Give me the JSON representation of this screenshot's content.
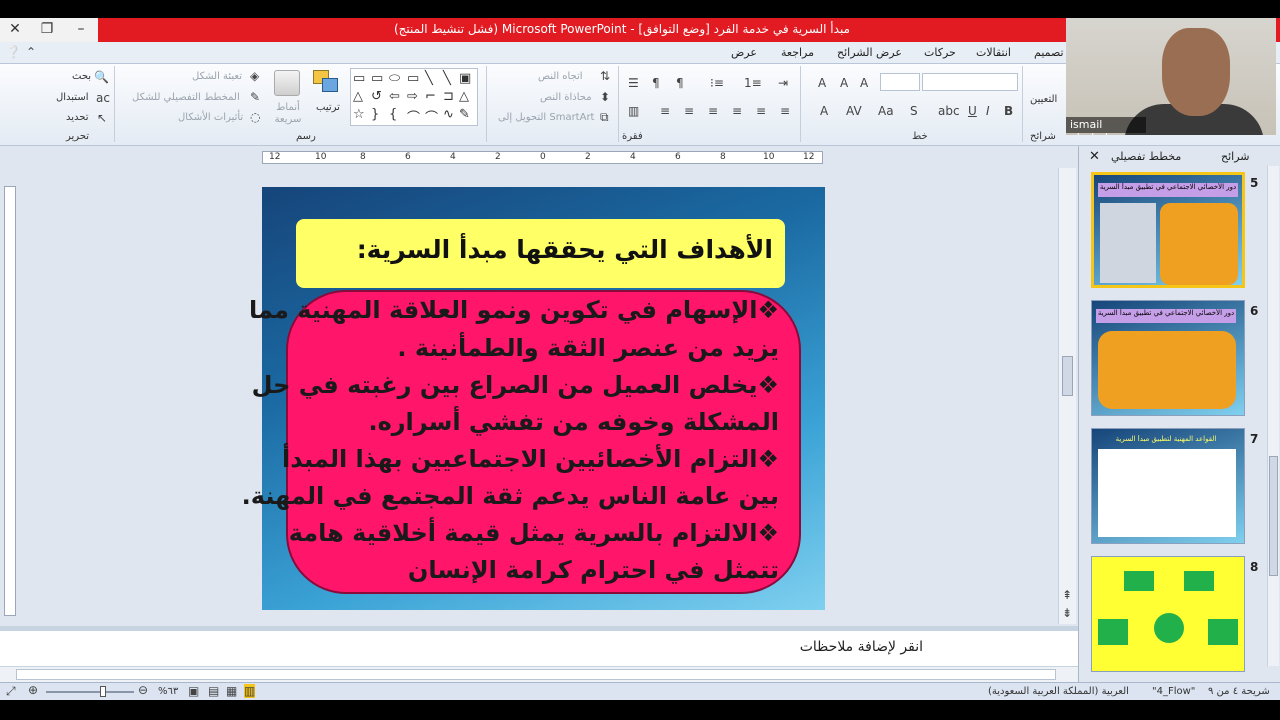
{
  "window": {
    "title": "مبدأ السرية في خدمة الفرد [وضع التوافق] - Microsoft PowerPoint (فشل تنشيط المنتج)",
    "colors": {
      "titlebar": "#e21b23",
      "slide_title_bg": "#ffff66",
      "slide_body_bg": "#ff1569"
    }
  },
  "ribbon_tabs": [
    "تصميم",
    "انتقالات",
    "حركات",
    "عرض الشرائح",
    "مراجعة",
    "عرض"
  ],
  "ribbon": {
    "editing": {
      "find": "بحث",
      "replace": "استبدال",
      "select": "تحديد",
      "group": "تحرير"
    },
    "drawing": {
      "fill": "تعبئة الشكل",
      "outline": "المخطط التفصيلي للشكل",
      "effects": "تأثيرات الأشكال",
      "quick_styles": "أنماط سريعة",
      "arrange": "ترتيب",
      "group": "رسم"
    },
    "paragraph": {
      "text_direction": "اتجاه النص",
      "align_text": "محاذاة النص",
      "smartart": "التحويل إلى SmartArt",
      "group": "فقرة"
    },
    "font": {
      "group": "خط"
    },
    "slides": {
      "reset": "التعيين",
      "group": "شرائح"
    }
  },
  "webcam": {
    "name": "ismail alruhal"
  },
  "slide": {
    "title": "الأهداف التي يحققها مبدأ السرية:",
    "body_lines": [
      "❖الإسهام في تكوين ونمو العلاقة المهنية مما",
      "يزيد من عنصر الثقة والطمأنينة .",
      "❖يخلص العميل من الصراع بين رغبته في حل",
      "المشكلة وخوفه من تفشي أسراره.",
      "❖التزام الأخصائيين الاجتماعيين بهذا المبدأ",
      "بين عامة الناس يدعم ثقة المجتمع في المهنة.",
      "❖الالتزام بالسرية يمثل قيمة أخلاقية هامة",
      "تتمثل في احترام كرامة الإنسان"
    ]
  },
  "notes": {
    "placeholder": "انقر لإضافة ملاحظات"
  },
  "panel": {
    "tabs": {
      "slides": "شرائح",
      "outline": "مخطط تفصيلي"
    },
    "thumbs": [
      {
        "num": "5",
        "title": "دور الأخصائي الاجتماعي في تطبيق مبدأ السرية"
      },
      {
        "num": "6",
        "title": "دور الأخصائي الاجتماعي في تطبيق مبدأ السرية"
      },
      {
        "num": "7",
        "title": "القواعد المهنية لتطبيق مبدأ السرية"
      },
      {
        "num": "8",
        "title": ""
      }
    ]
  },
  "ruler": {
    "ticks": [
      "12",
      "10",
      "8",
      "6",
      "4",
      "2",
      "0",
      "2",
      "4",
      "6",
      "8",
      "10",
      "12"
    ]
  },
  "status": {
    "slide_info": "شريحة ٤ من ٩",
    "theme": "\"4_Flow\"",
    "language": "العربية (المملكة العربية السعودية)",
    "zoom": "%٦٣"
  }
}
